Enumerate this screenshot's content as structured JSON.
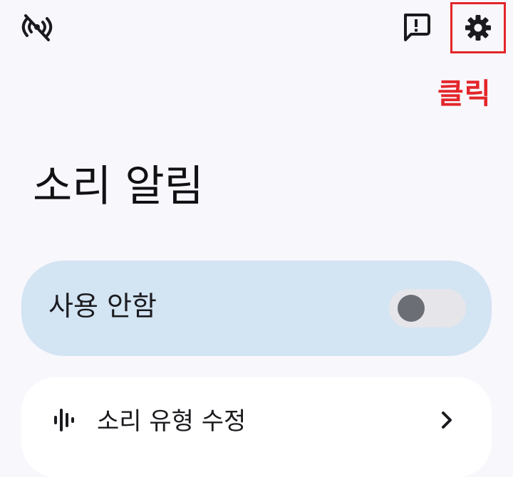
{
  "top_bar": {
    "left_icon": "signal-off-icon",
    "feedback_icon": "feedback-icon",
    "settings_icon": "gear-icon"
  },
  "annotation": {
    "label": "클릭",
    "color": "#e3262a"
  },
  "page": {
    "title": "소리 알림"
  },
  "toggle_card": {
    "label": "사용 안함",
    "state": "off",
    "background": "#d3e4f3"
  },
  "list": {
    "items": [
      {
        "icon": "waveform-icon",
        "label": "소리 유형 수정",
        "trailing_icon": "chevron-right-icon"
      }
    ]
  }
}
